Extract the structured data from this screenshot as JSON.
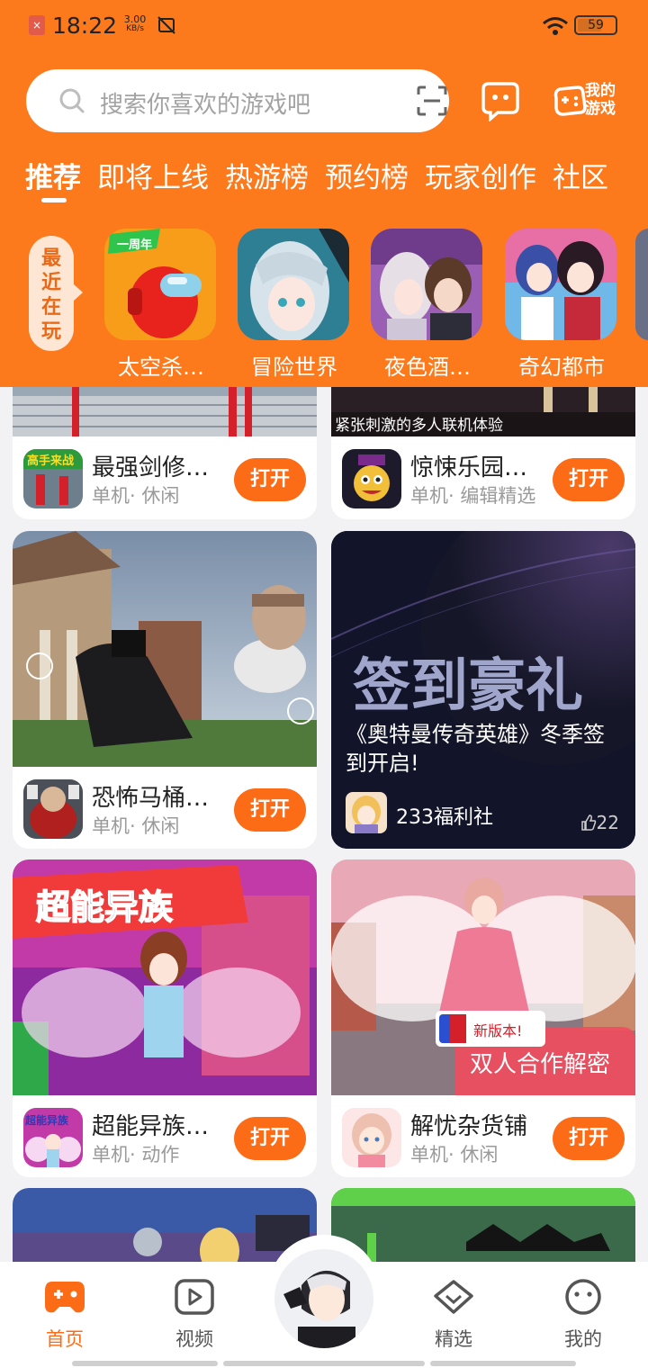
{
  "status_bar": {
    "time": "18:22",
    "speed_value": "3.00",
    "speed_unit": "KB/s",
    "battery": "59"
  },
  "search": {
    "placeholder": "搜索你喜欢的游戏吧"
  },
  "header_actions": {
    "my_games_line1": "我的",
    "my_games_line2": "游戏"
  },
  "tabs": [
    "推荐",
    "即将上线",
    "热游榜",
    "预约榜",
    "玩家创作",
    "社区"
  ],
  "recent": {
    "label_chars": [
      "最",
      "近",
      "在",
      "玩"
    ],
    "games": [
      {
        "name": "太空杀…",
        "badge": "一周年"
      },
      {
        "name": "冒险世界"
      },
      {
        "name": "夜色酒…"
      },
      {
        "name": "奇幻都市"
      }
    ]
  },
  "feed": {
    "open_label": "打开",
    "cards": [
      {
        "title": "最强剑修…",
        "sub": "单机· 休闲",
        "icon_text": "高手来战"
      },
      {
        "title": "惊悚乐园…",
        "sub": "单机· 编辑精选",
        "banner": "紧张刺激的多人联机体验"
      },
      {
        "title": "恐怖马桶…",
        "sub": "单机· 休闲"
      },
      {
        "title": "超能异族…",
        "sub": "单机· 动作",
        "banner_title": "超能异族",
        "icon_text": "超能异族"
      },
      {
        "title": "解忧杂货铺",
        "sub": "单机· 休闲",
        "badge": "新版本!",
        "banner": "双人合作解密"
      }
    ],
    "promo": {
      "headline": "签到豪礼",
      "description": "《奥特曼传奇英雄》冬季签到开启!",
      "author": "233福利社",
      "likes": "22"
    }
  },
  "bottom_nav": [
    {
      "label": "首页",
      "active": true
    },
    {
      "label": "视频"
    },
    {
      "label": "精选"
    },
    {
      "label": "我的"
    }
  ],
  "colors": {
    "accent": "#fc7a1c",
    "button": "#fc6b16"
  }
}
